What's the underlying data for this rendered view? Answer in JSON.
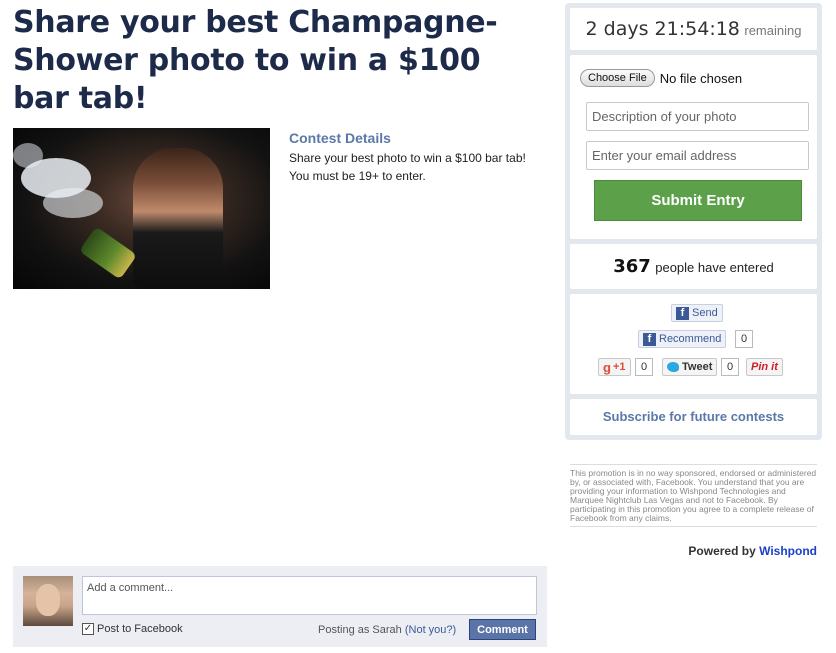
{
  "header": {
    "title": "Share your best Champagne-Shower photo to win a $100 bar tab!"
  },
  "contest": {
    "details_title": "Contest Details",
    "details_text": "Share your best photo to win a $100 bar tab! You must be 19+ to enter."
  },
  "timer": {
    "time": "2 days 21:54:18",
    "remaining": "remaining"
  },
  "form": {
    "choose_file": "Choose File",
    "no_file": "No file chosen",
    "description_placeholder": "Description of your photo",
    "email_placeholder": "Enter your email address",
    "submit": "Submit Entry"
  },
  "entries": {
    "count": "367",
    "label": "people have entered"
  },
  "social": {
    "send": "Send",
    "recommend": "Recommend",
    "recommend_count": "0",
    "gplus": "+1",
    "gplus_count": "0",
    "tweet": "Tweet",
    "tweet_count": "0",
    "pinit": "Pin it"
  },
  "subscribe": "Subscribe for future contests",
  "disclaimer": "This promotion is in no way sponsored, endorsed or administered by, or associated with, Facebook. You understand that you are providing your information to Wishpond Technologies and Marquee Nightclub Las Vegas and not to Facebook. By participating in this promotion you agree to a complete release of Facebook from any claims.",
  "powered": {
    "prefix": "Powered by",
    "brand": "Wishpond"
  },
  "comments": {
    "placeholder": "Add a comment...",
    "post_to_facebook": "Post to Facebook",
    "posting_as": "Posting as Sarah",
    "not_you": "(Not you?)",
    "button": "Comment"
  },
  "colors": {
    "accent_blue": "#5a78a8",
    "submit_green": "#5ca149",
    "fb_blue": "#3b5998"
  }
}
